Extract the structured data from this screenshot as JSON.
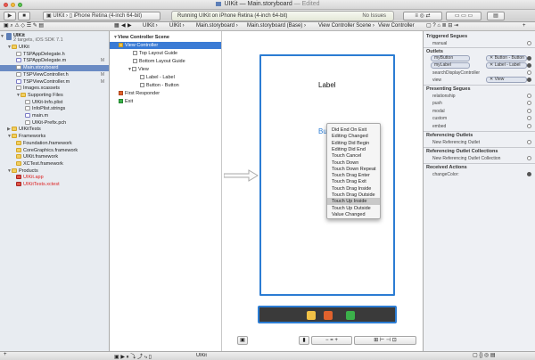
{
  "window": {
    "title": "UIKit",
    "separator": "—",
    "document": "Main.storyboard",
    "edited": "— Edited"
  },
  "toolbar": {
    "scheme_app": "UIKit",
    "scheme_device": "iPhone Retina (4-inch 64-bit)",
    "status": "Running UIKit on iPhone Retina (4-inch 64-bit)",
    "issues": "No Issues"
  },
  "jumpbar": {
    "crumbs": [
      "UIKit",
      "UIKit",
      "Main.storyboard",
      "Main.storyboard (Base)",
      "View Controller Scene",
      "View Controller"
    ]
  },
  "navigator": {
    "project": "UIKit",
    "project_sub": "2 targets, iOS SDK 7.1",
    "items": [
      {
        "label": "UIKit",
        "kind": "folder"
      },
      {
        "label": "TSPAppDelegate.h",
        "kind": "h"
      },
      {
        "label": "TSPAppDelegate.m",
        "kind": "m",
        "mark": "M"
      },
      {
        "label": "Main.storyboard",
        "kind": "sb"
      },
      {
        "label": "TSPViewController.h",
        "kind": "h",
        "mark": "M"
      },
      {
        "label": "TSPViewController.m",
        "kind": "m",
        "mark": "M"
      },
      {
        "label": "Images.xcassets",
        "kind": "assets"
      },
      {
        "label": "Supporting Files",
        "kind": "folder"
      },
      {
        "label": "UIKit-Info.plist",
        "kind": "plist"
      },
      {
        "label": "InfoPlist.strings",
        "kind": "strings"
      },
      {
        "label": "main.m",
        "kind": "m"
      },
      {
        "label": "UIKit-Prefix.pch",
        "kind": "h"
      },
      {
        "label": "UIKitTests",
        "kind": "folder"
      },
      {
        "label": "Frameworks",
        "kind": "folder"
      },
      {
        "label": "Foundation.framework",
        "kind": "framework"
      },
      {
        "label": "CoreGraphics.framework",
        "kind": "framework"
      },
      {
        "label": "UIKit.framework",
        "kind": "framework"
      },
      {
        "label": "XCTest.framework",
        "kind": "framework"
      },
      {
        "label": "Products",
        "kind": "folder"
      },
      {
        "label": "UIKit.app",
        "kind": "app"
      },
      {
        "label": "UIKitTests.xctest",
        "kind": "app"
      }
    ]
  },
  "outline": {
    "items": [
      {
        "label": "View Controller Scene"
      },
      {
        "label": "View Controller"
      },
      {
        "label": "Top Layout Guide"
      },
      {
        "label": "Bottom Layout Guide"
      },
      {
        "label": "View"
      },
      {
        "label": "Label - Label"
      },
      {
        "label": "Button - Button"
      },
      {
        "label": "First Responder"
      },
      {
        "label": "Exit"
      }
    ]
  },
  "canvas": {
    "label_text": "Label",
    "button_text": "Bu"
  },
  "context_menu": {
    "items": [
      "Did End On Exit",
      "Editing Changed",
      "Editing Did Begin",
      "Editing Did End",
      "Touch Cancel",
      "Touch Down",
      "Touch Down Repeat",
      "Touch Drag Enter",
      "Touch Drag Exit",
      "Touch Drag Inside",
      "Touch Drag Outside",
      "Touch Up Inside",
      "Touch Up Outside",
      "Value Changed"
    ],
    "highlighted": "Touch Up Inside"
  },
  "inspector": {
    "triggered_segues": {
      "title": "Triggered Segues",
      "items": [
        "manual"
      ]
    },
    "outlets": {
      "title": "Outlets",
      "items": [
        {
          "name": "myButton",
          "target": "Button - Button"
        },
        {
          "name": "myLabel",
          "target": "Label - Label"
        },
        {
          "name": "searchDisplayController",
          "target": ""
        },
        {
          "name": "view",
          "target": "View"
        }
      ]
    },
    "presenting_segues": {
      "title": "Presenting Segues",
      "items": [
        "relationship",
        "push",
        "modal",
        "custom",
        "embed"
      ]
    },
    "referencing_outlets": {
      "title": "Referencing Outlets",
      "items": [
        "New Referencing Outlet"
      ]
    },
    "referencing_outlet_collections": {
      "title": "Referencing Outlet Collections",
      "items": [
        "New Referencing Outlet Collection"
      ]
    },
    "received_actions": {
      "title": "Received Actions",
      "items": [
        "changeColor:"
      ]
    }
  },
  "debugbar": {
    "target": "UIKit"
  },
  "colors": {
    "selection": "#3a7bd5",
    "storyboard_border": "#2b7cd3",
    "navigator_bg": "#e8ecf1"
  }
}
